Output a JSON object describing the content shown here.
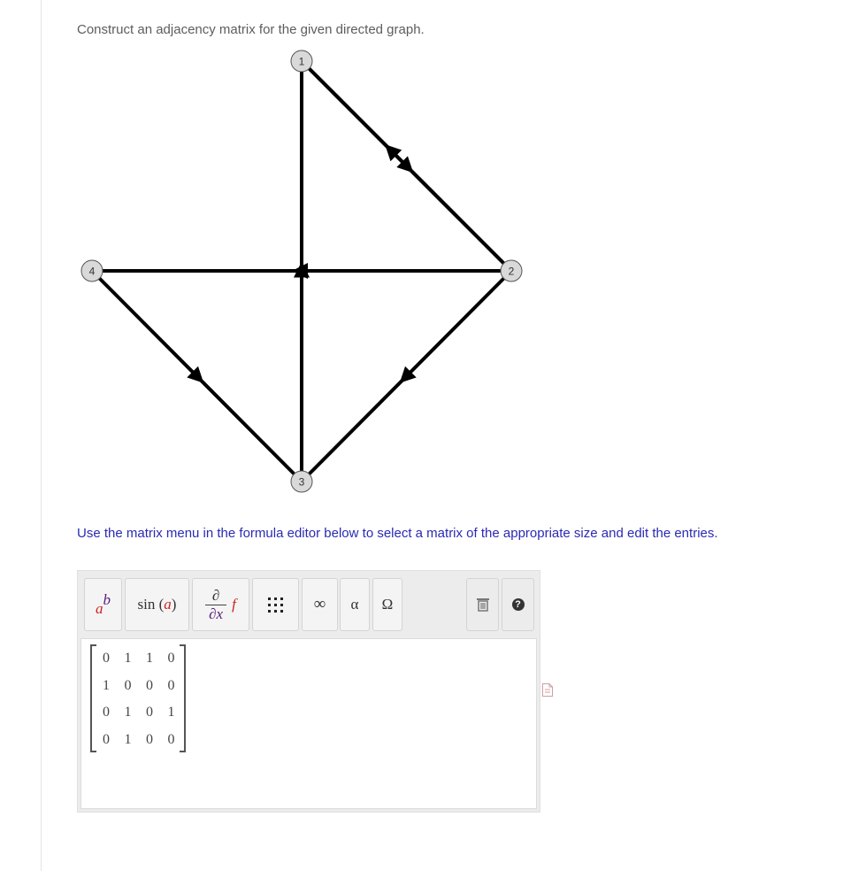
{
  "question": {
    "text": "Construct an adjacency matrix for the given directed graph."
  },
  "graph": {
    "nodes": [
      {
        "id": "1",
        "label": "1"
      },
      {
        "id": "2",
        "label": "2"
      },
      {
        "id": "3",
        "label": "3"
      },
      {
        "id": "4",
        "label": "4"
      }
    ],
    "edges": [
      {
        "from": "1",
        "to": "2"
      },
      {
        "from": "2",
        "to": "1"
      },
      {
        "from": "2",
        "to": "4"
      },
      {
        "from": "2",
        "to": "3"
      },
      {
        "from": "3",
        "to": "1"
      },
      {
        "from": "4",
        "to": "3"
      }
    ]
  },
  "instruction": {
    "text": "Use the matrix menu in the formula editor below to select a matrix of the appropriate size and edit the entries."
  },
  "toolbar": {
    "buttons": [
      {
        "name": "superscript-button",
        "base": "a",
        "exp": "b"
      },
      {
        "name": "trig-button",
        "fn": "sin",
        "arg": "a"
      },
      {
        "name": "derivative-button",
        "num": "∂",
        "den": "∂x",
        "f": "f"
      },
      {
        "name": "matrix-button",
        "icon": "grid-icon"
      },
      {
        "name": "infinity-button",
        "symbol": "∞"
      },
      {
        "name": "greek-button",
        "symbol": "α"
      },
      {
        "name": "symbols-button",
        "symbol": "Ω"
      },
      {
        "name": "delete-button",
        "icon": "trash-icon"
      },
      {
        "name": "help-button",
        "symbol": "?"
      }
    ]
  },
  "matrix": {
    "rows": [
      [
        "0",
        "1",
        "1",
        "0"
      ],
      [
        "1",
        "0",
        "0",
        "0"
      ],
      [
        "0",
        "1",
        "0",
        "1"
      ],
      [
        "0",
        "1",
        "0",
        "0"
      ]
    ]
  },
  "colors": {
    "instruction": "#2a2ab5",
    "superscript_base": "#cc2222",
    "superscript_exp": "#5b1e7a",
    "edge": "#000000",
    "node_fill": "#d9d9d9"
  }
}
